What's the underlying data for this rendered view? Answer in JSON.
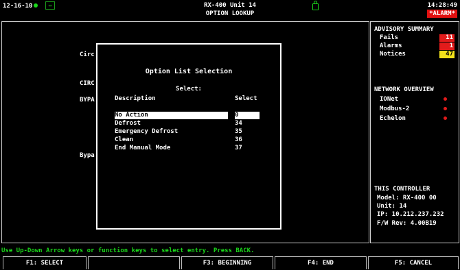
{
  "topbar": {
    "date": "12-16-10",
    "title_line1": "RX-400 Unit 14",
    "title_line2": "OPTION LOOKUP",
    "time": "14:28:49",
    "alarm_badge": "*ALARM*"
  },
  "background_labels": [
    "Circ",
    "CIRC",
    "BYPA",
    "Bypa"
  ],
  "dialog": {
    "title": "Option List Selection",
    "select_label": "Select:",
    "col_description": "Description",
    "col_select": "Select",
    "options": [
      {
        "description": "No Action",
        "value": "0",
        "selected": true
      },
      {
        "description": "Defrost",
        "value": "34",
        "selected": false
      },
      {
        "description": "Emergency Defrost",
        "value": "35",
        "selected": false
      },
      {
        "description": "Clean",
        "value": "36",
        "selected": false
      },
      {
        "description": "End Manual Mode",
        "value": "37",
        "selected": false
      }
    ]
  },
  "advisory": {
    "heading": "ADVISORY SUMMARY",
    "items": [
      {
        "label": "Fails",
        "count": "11",
        "color": "#e21b1b"
      },
      {
        "label": "Alarms",
        "count": "1",
        "color": "#e21b1b"
      },
      {
        "label": "Notices",
        "count": "47",
        "color": "#f2e21b"
      }
    ]
  },
  "network": {
    "heading": "NETWORK OVERVIEW",
    "items": [
      "IONet",
      "Modbus-2",
      "Echelon"
    ],
    "status_color": "#e21b1b"
  },
  "controller": {
    "heading": "THIS CONTROLLER",
    "model": "Model: RX-400  00",
    "unit": "Unit: 14",
    "ip": "IP: 10.212.237.232",
    "fw": "F/W Rev: 4.00B19"
  },
  "instruction": "Use Up-Down Arrow keys or function keys to select entry.  Press BACK.",
  "function_keys": [
    {
      "label": "F1: SELECT"
    },
    {
      "label": ""
    },
    {
      "label": "F3: BEGINNING"
    },
    {
      "label": "F4: END"
    },
    {
      "label": "F5: CANCEL"
    }
  ]
}
